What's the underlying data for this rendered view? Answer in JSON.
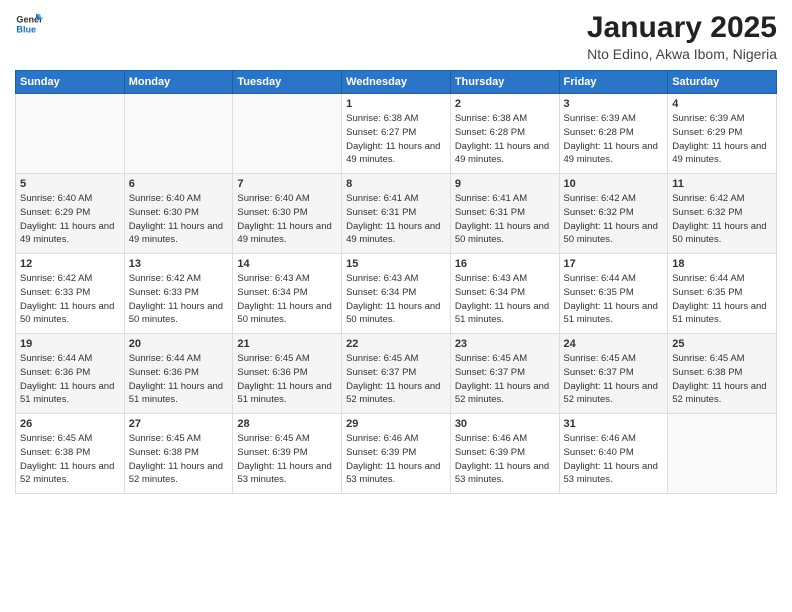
{
  "header": {
    "logo_general": "General",
    "logo_blue": "Blue",
    "main_title": "January 2025",
    "subtitle": "Nto Edino, Akwa Ibom, Nigeria"
  },
  "calendar": {
    "days_of_week": [
      "Sunday",
      "Monday",
      "Tuesday",
      "Wednesday",
      "Thursday",
      "Friday",
      "Saturday"
    ],
    "weeks": [
      [
        {
          "day": "",
          "info": ""
        },
        {
          "day": "",
          "info": ""
        },
        {
          "day": "",
          "info": ""
        },
        {
          "day": "1",
          "info": "Sunrise: 6:38 AM\nSunset: 6:27 PM\nDaylight: 11 hours and 49 minutes."
        },
        {
          "day": "2",
          "info": "Sunrise: 6:38 AM\nSunset: 6:28 PM\nDaylight: 11 hours and 49 minutes."
        },
        {
          "day": "3",
          "info": "Sunrise: 6:39 AM\nSunset: 6:28 PM\nDaylight: 11 hours and 49 minutes."
        },
        {
          "day": "4",
          "info": "Sunrise: 6:39 AM\nSunset: 6:29 PM\nDaylight: 11 hours and 49 minutes."
        }
      ],
      [
        {
          "day": "5",
          "info": "Sunrise: 6:40 AM\nSunset: 6:29 PM\nDaylight: 11 hours and 49 minutes."
        },
        {
          "day": "6",
          "info": "Sunrise: 6:40 AM\nSunset: 6:30 PM\nDaylight: 11 hours and 49 minutes."
        },
        {
          "day": "7",
          "info": "Sunrise: 6:40 AM\nSunset: 6:30 PM\nDaylight: 11 hours and 49 minutes."
        },
        {
          "day": "8",
          "info": "Sunrise: 6:41 AM\nSunset: 6:31 PM\nDaylight: 11 hours and 49 minutes."
        },
        {
          "day": "9",
          "info": "Sunrise: 6:41 AM\nSunset: 6:31 PM\nDaylight: 11 hours and 50 minutes."
        },
        {
          "day": "10",
          "info": "Sunrise: 6:42 AM\nSunset: 6:32 PM\nDaylight: 11 hours and 50 minutes."
        },
        {
          "day": "11",
          "info": "Sunrise: 6:42 AM\nSunset: 6:32 PM\nDaylight: 11 hours and 50 minutes."
        }
      ],
      [
        {
          "day": "12",
          "info": "Sunrise: 6:42 AM\nSunset: 6:33 PM\nDaylight: 11 hours and 50 minutes."
        },
        {
          "day": "13",
          "info": "Sunrise: 6:42 AM\nSunset: 6:33 PM\nDaylight: 11 hours and 50 minutes."
        },
        {
          "day": "14",
          "info": "Sunrise: 6:43 AM\nSunset: 6:34 PM\nDaylight: 11 hours and 50 minutes."
        },
        {
          "day": "15",
          "info": "Sunrise: 6:43 AM\nSunset: 6:34 PM\nDaylight: 11 hours and 50 minutes."
        },
        {
          "day": "16",
          "info": "Sunrise: 6:43 AM\nSunset: 6:34 PM\nDaylight: 11 hours and 51 minutes."
        },
        {
          "day": "17",
          "info": "Sunrise: 6:44 AM\nSunset: 6:35 PM\nDaylight: 11 hours and 51 minutes."
        },
        {
          "day": "18",
          "info": "Sunrise: 6:44 AM\nSunset: 6:35 PM\nDaylight: 11 hours and 51 minutes."
        }
      ],
      [
        {
          "day": "19",
          "info": "Sunrise: 6:44 AM\nSunset: 6:36 PM\nDaylight: 11 hours and 51 minutes."
        },
        {
          "day": "20",
          "info": "Sunrise: 6:44 AM\nSunset: 6:36 PM\nDaylight: 11 hours and 51 minutes."
        },
        {
          "day": "21",
          "info": "Sunrise: 6:45 AM\nSunset: 6:36 PM\nDaylight: 11 hours and 51 minutes."
        },
        {
          "day": "22",
          "info": "Sunrise: 6:45 AM\nSunset: 6:37 PM\nDaylight: 11 hours and 52 minutes."
        },
        {
          "day": "23",
          "info": "Sunrise: 6:45 AM\nSunset: 6:37 PM\nDaylight: 11 hours and 52 minutes."
        },
        {
          "day": "24",
          "info": "Sunrise: 6:45 AM\nSunset: 6:37 PM\nDaylight: 11 hours and 52 minutes."
        },
        {
          "day": "25",
          "info": "Sunrise: 6:45 AM\nSunset: 6:38 PM\nDaylight: 11 hours and 52 minutes."
        }
      ],
      [
        {
          "day": "26",
          "info": "Sunrise: 6:45 AM\nSunset: 6:38 PM\nDaylight: 11 hours and 52 minutes."
        },
        {
          "day": "27",
          "info": "Sunrise: 6:45 AM\nSunset: 6:38 PM\nDaylight: 11 hours and 52 minutes."
        },
        {
          "day": "28",
          "info": "Sunrise: 6:45 AM\nSunset: 6:39 PM\nDaylight: 11 hours and 53 minutes."
        },
        {
          "day": "29",
          "info": "Sunrise: 6:46 AM\nSunset: 6:39 PM\nDaylight: 11 hours and 53 minutes."
        },
        {
          "day": "30",
          "info": "Sunrise: 6:46 AM\nSunset: 6:39 PM\nDaylight: 11 hours and 53 minutes."
        },
        {
          "day": "31",
          "info": "Sunrise: 6:46 AM\nSunset: 6:40 PM\nDaylight: 11 hours and 53 minutes."
        },
        {
          "day": "",
          "info": ""
        }
      ]
    ]
  }
}
